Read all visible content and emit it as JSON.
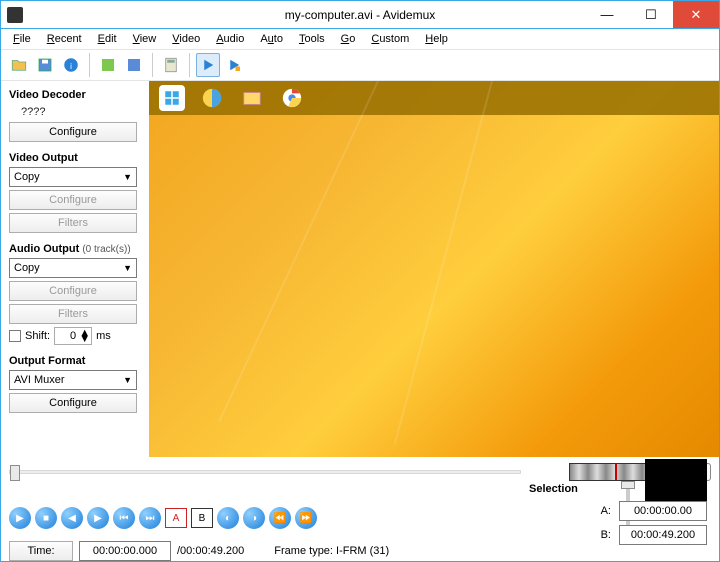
{
  "title": "my-computer.avi - Avidemux",
  "menu": [
    "File",
    "Recent",
    "Edit",
    "View",
    "Video",
    "Audio",
    "Auto",
    "Tools",
    "Go",
    "Custom",
    "Help"
  ],
  "sidebar": {
    "decoder_title": "Video Decoder",
    "decoder_value": "????",
    "video_output_title": "Video Output",
    "video_output_value": "Copy",
    "audio_output_title": "Audio Output",
    "audio_output_tracks": "(0 track(s))",
    "audio_output_value": "Copy",
    "shift_label": "Shift:",
    "shift_value": "0",
    "shift_unit": "ms",
    "format_title": "Output Format",
    "format_value": "AVI Muxer",
    "configure": "Configure",
    "filters": "Filters"
  },
  "selection": {
    "title": "Selection",
    "a_label": "A:",
    "a_value": "00:00:00.00",
    "b_label": "B:",
    "b_value": "00:00:49.200"
  },
  "time": {
    "button": "Time:",
    "current": "00:00:00.000",
    "total": "/00:00:49.200",
    "frame_type_label": "Frame type:",
    "frame_type_value": "I-FRM (31)"
  }
}
